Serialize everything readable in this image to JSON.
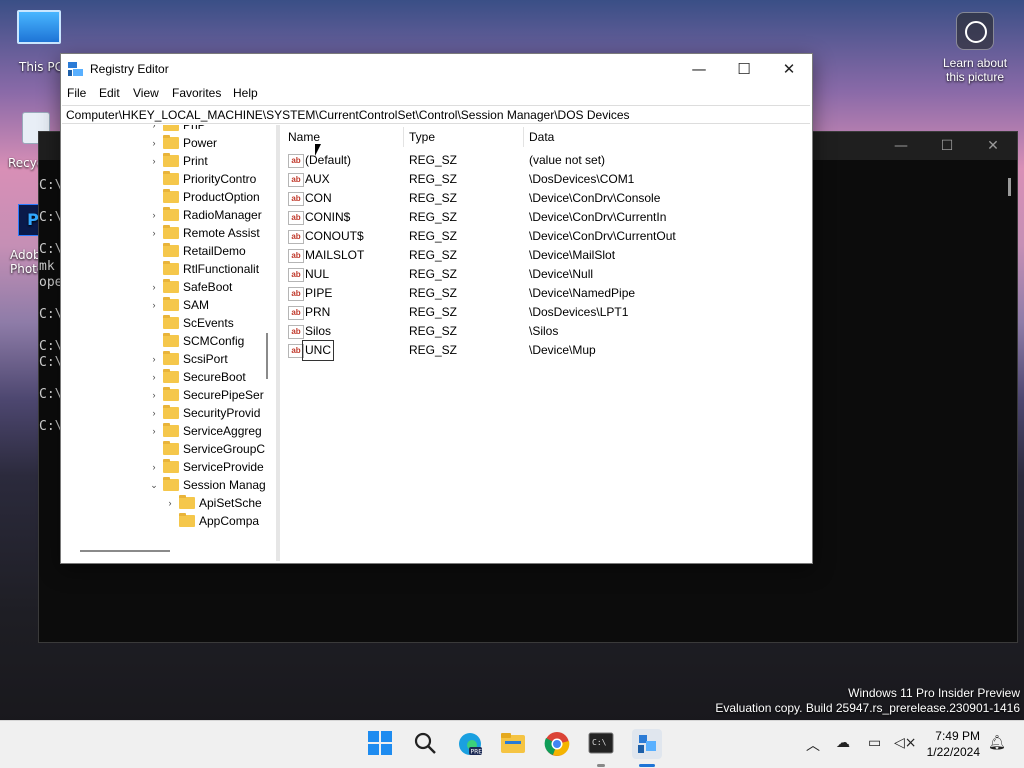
{
  "desktop": {
    "icons": [
      {
        "label": "This PC"
      },
      {
        "label": "Recycle"
      },
      {
        "label": "Adobe Photoshop"
      }
    ],
    "learn_about": "Learn about this picture",
    "watermark_line1": "Windows 11 Pro Insider Preview",
    "watermark_line2": "Evaluation copy. Build 25947.rs_prerelease.230901-1416"
  },
  "console": {
    "lines": [
      "C:\\",
      "C:\\",
      "C:\\",
      "mk",
      "ope",
      "C:\\",
      "C:\\",
      "C:\\",
      "C:\\",
      "C:\\"
    ]
  },
  "regedit": {
    "title": "Registry Editor",
    "menu": [
      "File",
      "Edit",
      "View",
      "Favorites",
      "Help"
    ],
    "address": "Computer\\HKEY_LOCAL_MACHINE\\SYSTEM\\CurrentControlSet\\Control\\Session Manager\\DOS Devices",
    "tree": [
      {
        "label": "PnP",
        "chev": "›"
      },
      {
        "label": "Power",
        "chev": "›"
      },
      {
        "label": "Print",
        "chev": "›"
      },
      {
        "label": "PriorityContro",
        "chev": ""
      },
      {
        "label": "ProductOption",
        "chev": ""
      },
      {
        "label": "RadioManager",
        "chev": "›"
      },
      {
        "label": "Remote Assist",
        "chev": "›"
      },
      {
        "label": "RetailDemo",
        "chev": ""
      },
      {
        "label": "RtlFunctionalit",
        "chev": ""
      },
      {
        "label": "SafeBoot",
        "chev": "›"
      },
      {
        "label": "SAM",
        "chev": "›"
      },
      {
        "label": "ScEvents",
        "chev": ""
      },
      {
        "label": "SCMConfig",
        "chev": ""
      },
      {
        "label": "ScsiPort",
        "chev": "›"
      },
      {
        "label": "SecureBoot",
        "chev": "›"
      },
      {
        "label": "SecurePipeSer",
        "chev": "›"
      },
      {
        "label": "SecurityProvid",
        "chev": "›"
      },
      {
        "label": "ServiceAggreg",
        "chev": "›"
      },
      {
        "label": "ServiceGroupC",
        "chev": ""
      },
      {
        "label": "ServiceProvide",
        "chev": "›"
      },
      {
        "label": "Session Manag",
        "chev": "⌄"
      },
      {
        "label": "ApiSetSche",
        "chev": "›"
      },
      {
        "label": "AppCompa",
        "chev": ""
      }
    ],
    "columns": [
      "Name",
      "Type",
      "Data"
    ],
    "values": [
      {
        "name": "(Default)",
        "type": "REG_SZ",
        "data": "(value not set)"
      },
      {
        "name": "AUX",
        "type": "REG_SZ",
        "data": "\\DosDevices\\COM1"
      },
      {
        "name": "CON",
        "type": "REG_SZ",
        "data": "\\Device\\ConDrv\\Console"
      },
      {
        "name": "CONIN$",
        "type": "REG_SZ",
        "data": "\\Device\\ConDrv\\CurrentIn"
      },
      {
        "name": "CONOUT$",
        "type": "REG_SZ",
        "data": "\\Device\\ConDrv\\CurrentOut"
      },
      {
        "name": "MAILSLOT",
        "type": "REG_SZ",
        "data": "\\Device\\MailSlot"
      },
      {
        "name": "NUL",
        "type": "REG_SZ",
        "data": "\\Device\\Null"
      },
      {
        "name": "PIPE",
        "type": "REG_SZ",
        "data": "\\Device\\NamedPipe"
      },
      {
        "name": "PRN",
        "type": "REG_SZ",
        "data": "\\DosDevices\\LPT1"
      },
      {
        "name": "Silos",
        "type": "REG_SZ",
        "data": "\\Silos"
      },
      {
        "name": "UNC",
        "type": "REG_SZ",
        "data": "\\Device\\Mup"
      }
    ]
  },
  "taskbar": {
    "time": "7:49 PM",
    "date": "1/22/2024",
    "pinned": [
      "start-icon",
      "search-icon",
      "edge-icon",
      "file-explorer-icon",
      "chrome-icon",
      "terminal-icon",
      "regedit-icon"
    ]
  }
}
